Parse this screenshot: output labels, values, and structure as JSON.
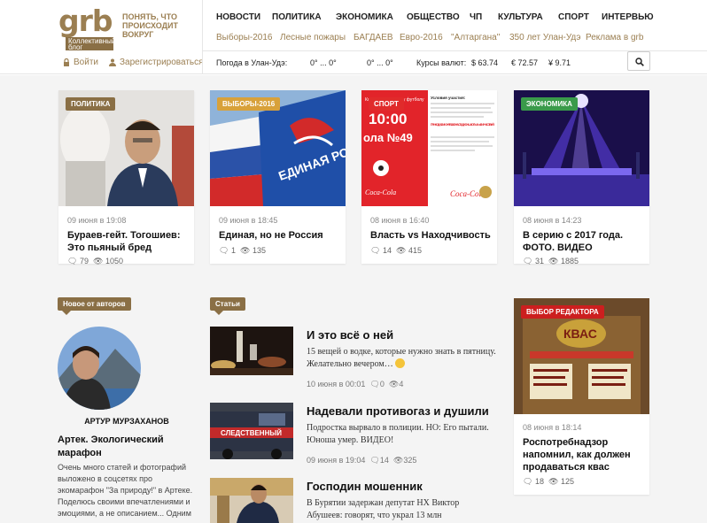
{
  "logo": {
    "word": "grb",
    "badge": "Коллективный блог",
    "tagline": "Понять, что происходит вокруг"
  },
  "auth": {
    "login": "Войти",
    "register": "Зарегистрироваться"
  },
  "nav": [
    "НОВОСТИ",
    "ПОЛИТИКА",
    "ЭКОНОМИКА",
    "ОБЩЕСТВО",
    "ЧП",
    "КУЛЬТУРА",
    "СПОРТ",
    "ИНТЕРВЬЮ"
  ],
  "subnav": [
    "Выборы-2016",
    "Лесные пожары",
    "БАГДАЕВ",
    "Евро-2016",
    "\"Алтаргана\"",
    "350 лет Улан-Удэ",
    "Реклама в grb"
  ],
  "info": {
    "weather_label": "Погода в Улан-Удэ:",
    "temp1": "0° ... 0°",
    "temp2": "0° ... 0°",
    "rates_label": "Курсы валют:",
    "usd": "$ 63.74",
    "eur": "€ 72.57",
    "cny": "¥ 9.71"
  },
  "colors": {
    "politics": "#8a6f45",
    "elections": "#d8a13a",
    "sport": "#e02b2b",
    "economy": "#3a9a4a",
    "editor": "#cc1f1f",
    "brand": "#9b7f52"
  },
  "cards": [
    {
      "tag": "ПОЛИТИКА",
      "date": "09 июня в 19:08",
      "title": "Бураев-гейт. Тогошиев: Это пьяный бред",
      "comments": "79",
      "views": "1050"
    },
    {
      "tag": "ВЫБОРЫ-2016",
      "date": "09 июня в 18:45",
      "title": "Единая, но не Россия",
      "comments": "1",
      "views": "135"
    },
    {
      "tag": "СПОРТ",
      "date": "08 июня в 16:40",
      "title": "Власть vs Находчивость",
      "comments": "14",
      "views": "415"
    },
    {
      "tag": "ЭКОНОМИКА",
      "date": "08 июня в 14:23",
      "title": "В серию с 2017 года. ФОТО. ВИДЕО",
      "comments": "31",
      "views": "1885"
    }
  ],
  "card_images": {
    "party_banner": "ЕДИНАЯ РОССИЯ",
    "poster_header": "Ко Всероссийскому футболу",
    "poster_time": "10:00",
    "poster_school": "ола №49",
    "poster_title": "Условия участия:",
    "poster_brand": "Coca-Cola",
    "poster_small": "ПРИХОДИ 12 ИЮНЯ В 10:00 НА СТАДИОН ШКОЛЫ №49 И УЧАСТВУЙ!"
  },
  "authors": {
    "label": "Новое от авторов",
    "name": "АРТУР МУРЗАХАНОВ",
    "title": "Артек. Экологический марафон",
    "text": "Очень много статей и фотографий выложено в соцсетях про экомарафон \"За природу!\" в Артеке. Поделюсь своими впечатлениями и эмоциями, а не описанием... Одним предложением много сказать, это"
  },
  "articles_label": "Статьи",
  "articles": [
    {
      "title": "И это всё о ней",
      "excerpt": "15 вещей о водке, которые нужно знать в пятницу. Желательно вечером…",
      "date": "10 июня в 00:01",
      "comments": "0",
      "views": "4"
    },
    {
      "title": "Надевали противогаз и душили",
      "excerpt": "Подростка вырвало в полиции. НО: Его пытали. Юноша умер. ВИДЕО!",
      "date": "09 июня в 19:04",
      "comments": "14",
      "views": "325"
    },
    {
      "title": "Господин мошенник",
      "excerpt": "В Бурятии задержан депутат НХ Виктор Абушеев: говорят, что украл 13 млн",
      "date": "",
      "comments": "",
      "views": ""
    }
  ],
  "article_image_text": {
    "van": "СЛЕДСТВЕННЫЙ"
  },
  "editor": {
    "label": "ВЫБОР РЕДАКТОРА",
    "kvas": "КВАС",
    "date": "08 июня в 18:14",
    "title": "Роспотребнадзор напомнил, как должен продаваться квас",
    "comments": "18",
    "views": "125"
  }
}
